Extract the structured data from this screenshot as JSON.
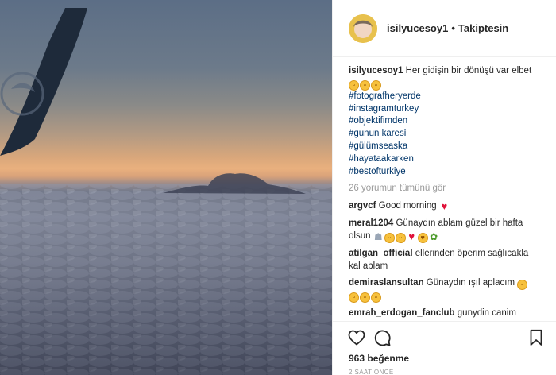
{
  "post": {
    "username": "isilyucesoy1",
    "separator": "•",
    "follow_status": "Takiptesin",
    "caption": {
      "user": "isilyucesoy1",
      "text": "Her gidişin bir dönüşü var elbet",
      "emojis": [
        "grinning",
        "grinning",
        "grinning"
      ],
      "hashtags": [
        "#fotografheryerde",
        "#instagramturkey",
        "#objektifimden",
        "#gunun karesi",
        "#gülümseaska",
        "#hayataakarken",
        "#bestofturkiye"
      ]
    },
    "view_all_comments": "26 yorumun tümünü gör",
    "comments": [
      {
        "user": "argvcf",
        "text": "Good morning",
        "emojis": [
          "heart"
        ]
      },
      {
        "user": "meral1204",
        "text": "Günaydın ablam güzel bir hafta olsun",
        "emojis": [
          "pray",
          "grinning",
          "grinning",
          "heart",
          "heart-eyes",
          "bouquet"
        ]
      },
      {
        "user": "atilgan_official",
        "text": "ellerinden öperim sağlıcakla kal ablam",
        "emojis": []
      },
      {
        "user": "demiraslansultan",
        "text": "Günaydın ışıl aplacım",
        "emojis": [
          "grinning",
          "grinning",
          "grinning",
          "grinning"
        ]
      },
      {
        "user": "emrah_erdogan_fanclub",
        "text": "gunydin canim",
        "emojis": []
      }
    ],
    "likes_count": "963",
    "likes_label": "beğenme",
    "timestamp": "2 SAAT ÖNCE"
  },
  "icons": {
    "like": "heart-outline-icon",
    "comment": "speech-bubble-icon",
    "save": "bookmark-icon"
  },
  "colors": {
    "hashtag": "#003569",
    "muted": "#999999",
    "text": "#262626",
    "heart": "#e0123a"
  }
}
